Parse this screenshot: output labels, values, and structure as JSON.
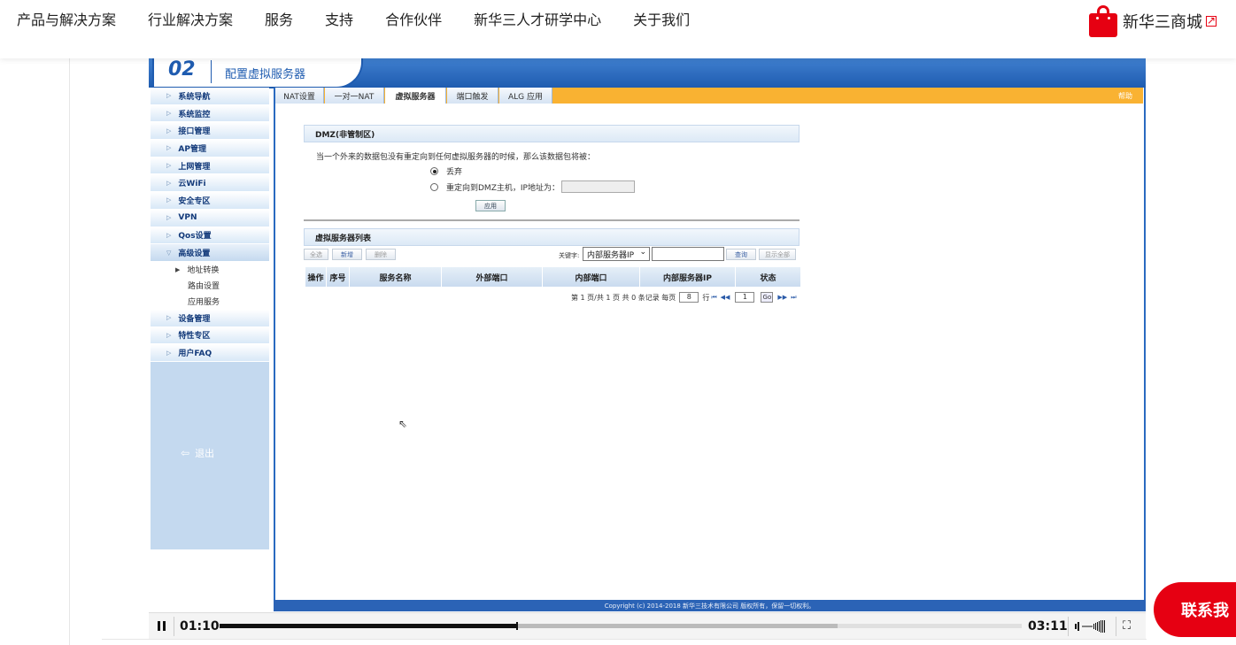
{
  "site_nav": {
    "items": [
      "产品与解决方案",
      "行业解决方案",
      "服务",
      "支持",
      "合作伙伴",
      "新华三人才研学中心",
      "关于我们"
    ],
    "store_label": "新华三商城"
  },
  "video": {
    "step_number": "02",
    "step_title": "配置虚拟服务器",
    "sidebar": {
      "items_top": [
        "系统导航",
        "系统监控",
        "接口管理",
        "AP管理",
        "上网管理",
        "云WiFi",
        "安全专区",
        "VPN",
        "Qos设置"
      ],
      "active_item": "高级设置",
      "subitems": [
        "地址转换",
        "路由设置",
        "应用服务"
      ],
      "items_bottom": [
        "设备管理",
        "特性专区",
        "用户FAQ"
      ],
      "logout": "退出"
    },
    "tabs": [
      "NAT设置",
      "一对一NAT",
      "虚拟服务器",
      "端口触发",
      "ALG 应用"
    ],
    "active_tab": "虚拟服务器",
    "help": "帮助",
    "dmz": {
      "title": "DMZ(非管制区)",
      "description": "当一个外来的数据包没有重定向到任何虚拟服务器的时候，那么该数据包将被：",
      "option_discard": "丢弃",
      "option_redirect": "重定向到DMZ主机，IP地址为：",
      "ip_value": "",
      "apply": "应用"
    },
    "vs_list": {
      "title": "虚拟服务器列表",
      "buttons": [
        "全选",
        "新增",
        "删除"
      ],
      "keyword_label": "关键字:",
      "keyword_select": "内部服务器IP",
      "keyword_value": "",
      "search": "查询",
      "show_all": "显示全部",
      "columns": [
        "操作",
        "序号",
        "服务名称",
        "外部端口",
        "内部端口",
        "内部服务器IP",
        "状态"
      ],
      "pager": {
        "text1": "第 1 页/共 1 页 共 0 条记录 每页",
        "per_page": "8",
        "text2": "行",
        "page": "1",
        "go": "Go"
      }
    },
    "copyright": "Copyright (c) 2014-2018 新华三技术有限公司 版权所有，保留一切权利。",
    "player": {
      "current_time": "01:10",
      "total_time": "03:11",
      "played_fraction": 0.37,
      "buffered_fraction": 0.77
    }
  },
  "contact_label": "联系我"
}
